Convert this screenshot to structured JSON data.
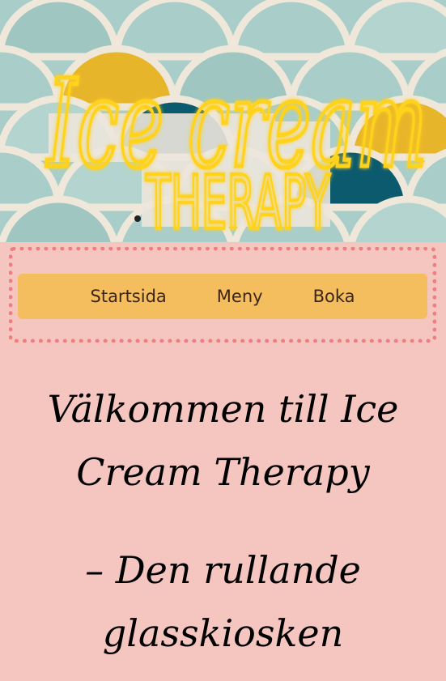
{
  "hero": {
    "sign_line1": "Ice cream",
    "sign_line2": "THERAPY"
  },
  "nav": {
    "items": [
      "Startsida",
      "Meny",
      "Boka"
    ]
  },
  "main": {
    "heading1": "Välkommen till Ice Cream Therapy",
    "heading2": "– Den rullande glasskiosken"
  },
  "colors": {
    "page_background": "#f5c5c0",
    "nav_background": "#f4bd5d",
    "nav_border": "#f07d80",
    "neon": "#ffd21e"
  }
}
